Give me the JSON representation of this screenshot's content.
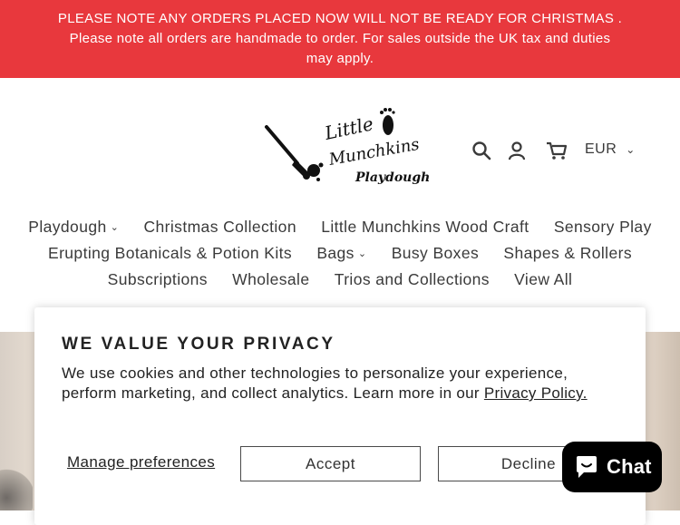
{
  "announcement": {
    "line1": "PLEASE NOTE ANY ORDERS PLACED NOW WILL NOT BE READY FOR CHRISTMAS .",
    "line2": "Please note all orders are handmade to order. For sales outside the UK tax and duties",
    "line3": "may apply.",
    "background_color": "#e8383d"
  },
  "header": {
    "logo": {
      "line1": "Little",
      "line2": "Munchkins",
      "line3": "Playdough"
    },
    "icons": [
      "search-icon",
      "account-icon",
      "cart-icon"
    ],
    "currency": {
      "selected": "EUR"
    }
  },
  "nav": {
    "row1": [
      {
        "label": "Playdough",
        "has_dropdown": true
      },
      {
        "label": "Christmas Collection",
        "has_dropdown": false
      },
      {
        "label": "Little Munchkins Wood Craft",
        "has_dropdown": false
      },
      {
        "label": "Sensory Play",
        "has_dropdown": false
      }
    ],
    "row2": [
      {
        "label": "Erupting Botanicals & Potion Kits",
        "has_dropdown": false
      },
      {
        "label": "Bags",
        "has_dropdown": true
      },
      {
        "label": "Busy Boxes",
        "has_dropdown": false
      },
      {
        "label": "Shapes & Rollers",
        "has_dropdown": false
      }
    ],
    "row3": [
      {
        "label": "Subscriptions",
        "has_dropdown": false
      },
      {
        "label": "Wholesale",
        "has_dropdown": false
      },
      {
        "label": "Trios and Collections",
        "has_dropdown": false
      },
      {
        "label": "View All",
        "has_dropdown": false
      }
    ]
  },
  "privacy_modal": {
    "title": "WE VALUE YOUR PRIVACY",
    "body": "We use cookies and other technologies to personalize your experience, perform marketing, and collect analytics. Learn more in our ",
    "link": "Privacy Policy.",
    "manage_label": "Manage preferences",
    "accept_label": "Accept",
    "decline_label": "Decline"
  },
  "chat": {
    "label": "Chat",
    "icon": "chat-bubble-icon"
  }
}
